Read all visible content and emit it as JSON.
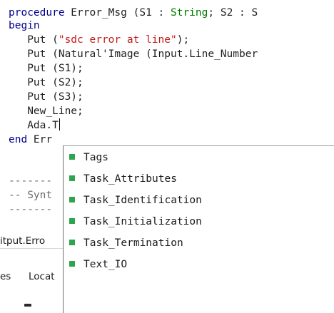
{
  "editor": {
    "lines": [
      {
        "kw1": "procedure",
        "text1": " Error_Msg (S1 : ",
        "type1": "String",
        "text2": "; S2 : S"
      },
      {
        "kw1": "begin"
      },
      {
        "text1": "   Put (",
        "str1": "\"sdc error at line\"",
        "text2": ");"
      },
      {
        "text1": "   Put (Natural'Image (Input.Line_Number"
      },
      {
        "text1": "   Put (S1);"
      },
      {
        "text1": "   Put (S2);"
      },
      {
        "text1": "   Put (S3);"
      },
      {
        "text1": "   New_Line;"
      },
      {
        "text1": "   Ada.T"
      },
      {
        "kw1": "end",
        "text1": " Err"
      },
      {
        "text1": ""
      },
      {
        "cmt1": "-------"
      },
      {
        "cmt1": "-- Synt"
      },
      {
        "cmt1": "-------"
      }
    ]
  },
  "bottom": {
    "tab_text": "itput.Erro",
    "left_tab_partial": "es",
    "locations_partial": "Locat"
  },
  "completion": {
    "items": [
      "Tags",
      "Task_Attributes",
      "Task_Identification",
      "Task_Initialization",
      "Task_Termination",
      "Text_IO"
    ],
    "marker_color": "#2ea44f"
  }
}
